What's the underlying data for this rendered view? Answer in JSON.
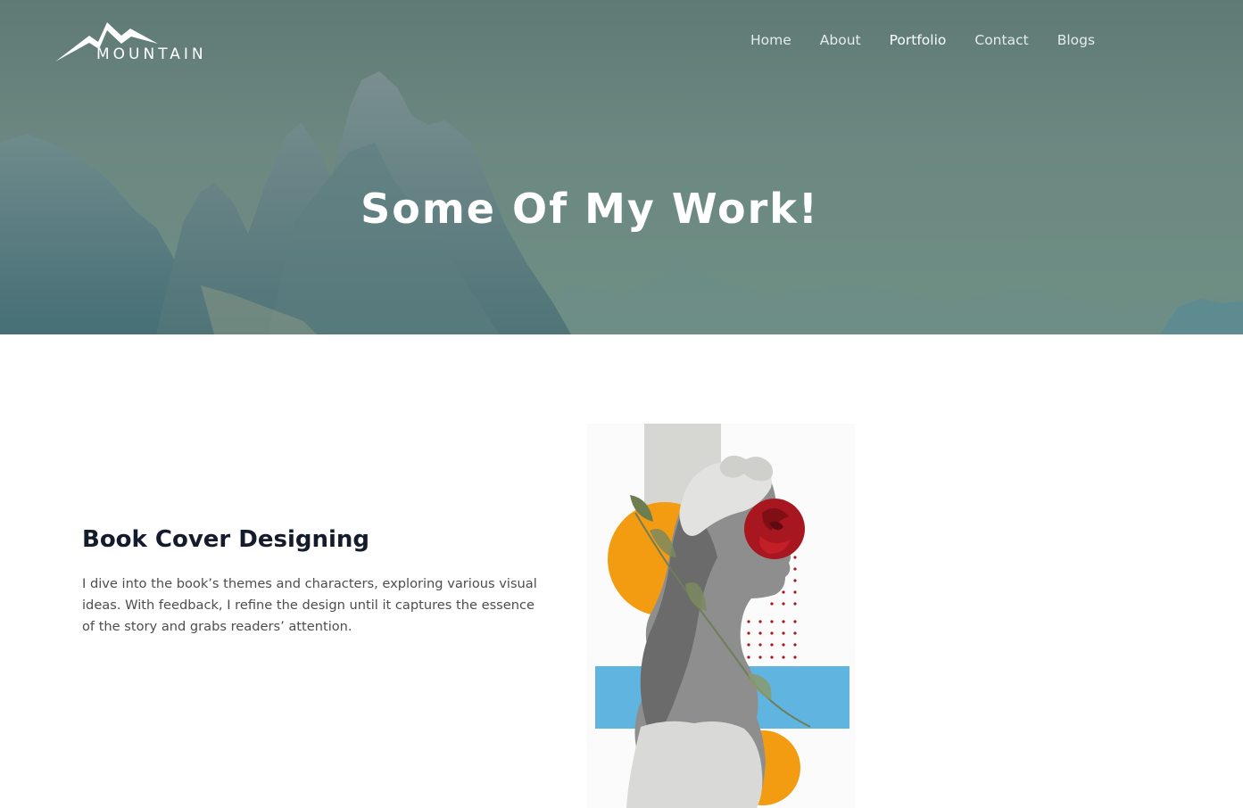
{
  "header": {
    "logo_text": "MOUNTAIN",
    "nav": [
      {
        "label": "Home",
        "active": false
      },
      {
        "label": "About",
        "active": false
      },
      {
        "label": "Portfolio",
        "active": true
      },
      {
        "label": "Contact",
        "active": false
      },
      {
        "label": "Blogs",
        "active": false
      }
    ]
  },
  "hero": {
    "title": "Some Of My Work!"
  },
  "portfolio": {
    "items": [
      {
        "title": "Book Cover Designing",
        "description": "I dive into the book’s themes and characters, exploring various visual ideas. With feedback, I refine the design until it captures the essence of the story and grabs readers’ attention."
      }
    ]
  },
  "colors": {
    "hero_overlay": "#6a8781",
    "title_text": "#141b2c",
    "body_text": "#4d4d4d",
    "art_orange": "#f39c12",
    "art_blue": "#5fb5e0",
    "art_red": "#a8161f"
  }
}
